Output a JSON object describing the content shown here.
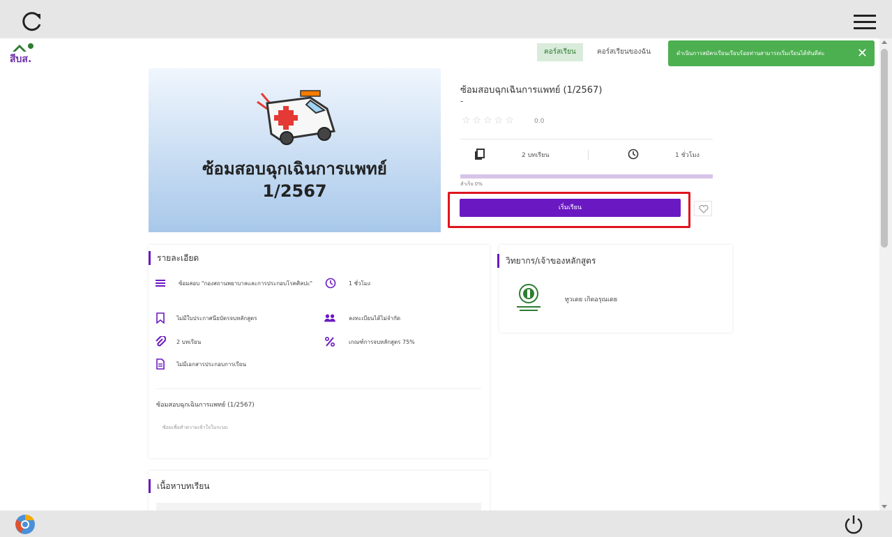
{
  "nav": {
    "logo_text": "สีบส.",
    "tab_courses": "คอร์สเรียน",
    "tab_my_courses": "คอร์สเรียนของฉัน"
  },
  "toast": {
    "message": "ดำเนินการสมัครเรียนเรียบร้อยท่านสามารถเริ่มเรียนได้ทันทีค่ะ",
    "close": "✕"
  },
  "banner": {
    "title_line1": "ซ้อมสอบฉุกเฉินการแพทย์",
    "title_line2": "1/2567"
  },
  "course": {
    "title": "ซ้อมสอบฉุกเฉินการแพทย์ (1/2567)",
    "subtitle": "-",
    "stars": "☆☆☆☆☆",
    "rating_value": "0.0",
    "lessons": "2 บทเรียน",
    "hours": "1 ชั่วโมง",
    "progress_label": "สำเร็จ 0%",
    "progress_percent": 0,
    "start_button": "เริ่มเรียน"
  },
  "details": {
    "heading": "รายละเอียด",
    "category": "ซ้อมสอบ \"กองสถานพยาบาลและการประกอบโรคศิลปะ\"",
    "duration": "1 ชั่วโมง",
    "certificate": "ไม่มีใบประกาศนียบัตรจบหลักสูตร",
    "enrollment": "ลงทะเบียนได้ไม่จำกัด",
    "lessons": "2 บทเรียน",
    "criteria": "เกณฑ์การจบหลักสูตร 75%",
    "documents": "ไม่มีเอกสารประกอบการเรียน",
    "sub_title": "ซ้อมสอบฉุกเฉินการแพทย์ (1/2567)",
    "sub_desc": "ซ้อมเพื่อทำความเข้าใจในระบบ"
  },
  "instructor": {
    "heading": "วิทยากร/เจ้าของหลักสูตร",
    "name": "ทูวเดย เกิดอรุณเดย"
  },
  "content": {
    "heading": "เนื้อหาบทเรียน"
  },
  "colors": {
    "accent": "#6a19c2",
    "toast": "#4caf50",
    "highlight": "#e0141e"
  }
}
